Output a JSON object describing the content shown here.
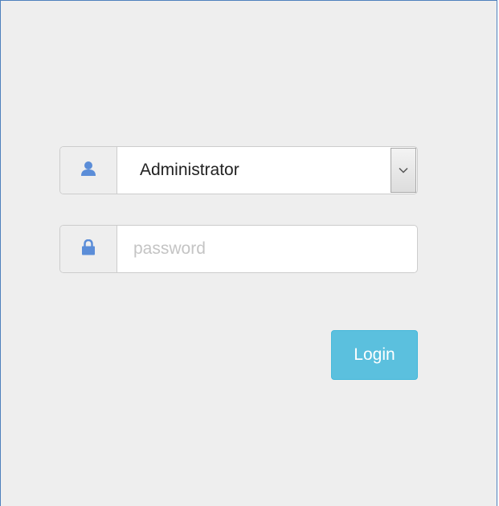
{
  "login_form": {
    "user_select": {
      "icon": "user-icon",
      "selected_value": "Administrator",
      "arrow_icon": "chevron-down-icon"
    },
    "password_field": {
      "icon": "lock-icon",
      "value": "",
      "placeholder": "password"
    },
    "submit_label": "Login"
  },
  "colors": {
    "background": "#eeeeee",
    "icon": "#5b8dd8",
    "button": "#5bc0de",
    "frame_border": "#4f81bd"
  }
}
